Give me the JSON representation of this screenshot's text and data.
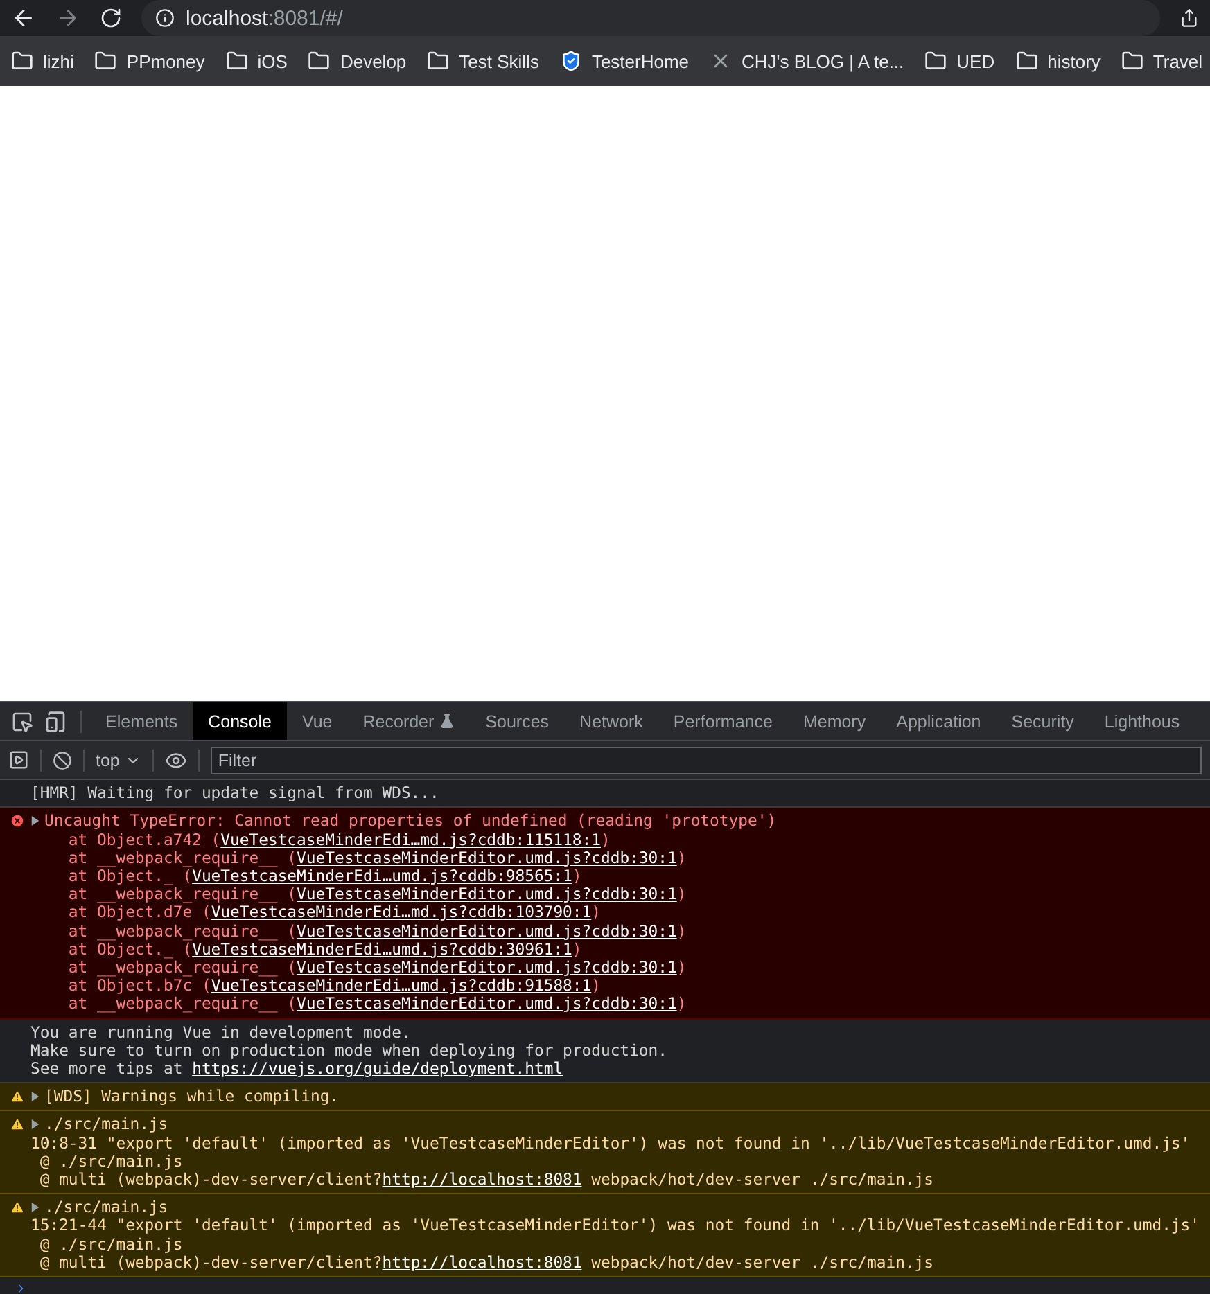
{
  "address_bar": {
    "host": "localhost",
    "path": ":8081/#/"
  },
  "bookmarks": [
    {
      "label": "lizhi",
      "kind": "folder"
    },
    {
      "label": "PPmoney",
      "kind": "folder"
    },
    {
      "label": "iOS",
      "kind": "folder"
    },
    {
      "label": "Develop",
      "kind": "folder"
    },
    {
      "label": "Test Skills",
      "kind": "folder"
    },
    {
      "label": "TesterHome",
      "kind": "shield"
    },
    {
      "label": "CHJ's BLOG | A te...",
      "kind": "site"
    },
    {
      "label": "UED",
      "kind": "folder"
    },
    {
      "label": "history",
      "kind": "folder"
    },
    {
      "label": "Travel",
      "kind": "folder"
    }
  ],
  "devtools": {
    "tabs": [
      {
        "label": "Elements",
        "selected": false
      },
      {
        "label": "Console",
        "selected": true
      },
      {
        "label": "Vue",
        "selected": false
      },
      {
        "label": "Recorder",
        "selected": false,
        "kind": "experimental"
      },
      {
        "label": "Sources",
        "selected": false
      },
      {
        "label": "Network",
        "selected": false
      },
      {
        "label": "Performance",
        "selected": false
      },
      {
        "label": "Memory",
        "selected": false
      },
      {
        "label": "Application",
        "selected": false
      },
      {
        "label": "Security",
        "selected": false
      },
      {
        "label": "Lighthous",
        "selected": false
      }
    ],
    "context": "top",
    "filter": {
      "placeholder": "Filter"
    }
  },
  "console": [
    {
      "kind": "log",
      "lines": [
        [
          {
            "text": "[HMR] Waiting for update signal from WDS..."
          }
        ]
      ]
    },
    {
      "kind": "error",
      "expanded": false,
      "lines": [
        [
          {
            "text": "Uncaught TypeError: Cannot read properties of undefined (reading 'prototype')"
          }
        ],
        [
          {
            "text": "    at Object.a742 ("
          },
          {
            "text": "VueTestcaseMinderEdi…md.js?cddb:115118:1",
            "kind": "link"
          },
          {
            "text": ")"
          }
        ],
        [
          {
            "text": "    at __webpack_require__ ("
          },
          {
            "text": "VueTestcaseMinderEditor.umd.js?cddb:30:1",
            "kind": "link"
          },
          {
            "text": ")"
          }
        ],
        [
          {
            "text": "    at Object._ ("
          },
          {
            "text": "VueTestcaseMinderEdi…umd.js?cddb:98565:1",
            "kind": "link"
          },
          {
            "text": ")"
          }
        ],
        [
          {
            "text": "    at __webpack_require__ ("
          },
          {
            "text": "VueTestcaseMinderEditor.umd.js?cddb:30:1",
            "kind": "link"
          },
          {
            "text": ")"
          }
        ],
        [
          {
            "text": "    at Object.d7e ("
          },
          {
            "text": "VueTestcaseMinderEdi…md.js?cddb:103790:1",
            "kind": "link"
          },
          {
            "text": ")"
          }
        ],
        [
          {
            "text": "    at __webpack_require__ ("
          },
          {
            "text": "VueTestcaseMinderEditor.umd.js?cddb:30:1",
            "kind": "link"
          },
          {
            "text": ")"
          }
        ],
        [
          {
            "text": "    at Object._ ("
          },
          {
            "text": "VueTestcaseMinderEdi…umd.js?cddb:30961:1",
            "kind": "link"
          },
          {
            "text": ")"
          }
        ],
        [
          {
            "text": "    at __webpack_require__ ("
          },
          {
            "text": "VueTestcaseMinderEditor.umd.js?cddb:30:1",
            "kind": "link"
          },
          {
            "text": ")"
          }
        ],
        [
          {
            "text": "    at Object.b7c ("
          },
          {
            "text": "VueTestcaseMinderEdi…umd.js?cddb:91588:1",
            "kind": "link"
          },
          {
            "text": ")"
          }
        ],
        [
          {
            "text": "    at __webpack_require__ ("
          },
          {
            "text": "VueTestcaseMinderEditor.umd.js?cddb:30:1",
            "kind": "link"
          },
          {
            "text": ")"
          }
        ]
      ]
    },
    {
      "kind": "log",
      "lines": [
        [
          {
            "text": "You are running Vue in development mode."
          }
        ],
        [
          {
            "text": "Make sure to turn on production mode when deploying for production."
          }
        ],
        [
          {
            "text": "See more tips at "
          },
          {
            "text": "https://vuejs.org/guide/deployment.html",
            "kind": "link"
          }
        ]
      ]
    },
    {
      "kind": "warning",
      "expanded": false,
      "lines": [
        [
          {
            "text": "[WDS] Warnings while compiling."
          }
        ]
      ]
    },
    {
      "kind": "warning",
      "expanded": false,
      "lines": [
        [
          {
            "text": "./src/main.js"
          }
        ],
        [
          {
            "text": "10:8-31 \"export 'default' (imported as 'VueTestcaseMinderEditor') was not found in '../lib/VueTestcaseMinderEditor.umd.js'"
          }
        ],
        [
          {
            "text": " @ ./src/main.js"
          }
        ],
        [
          {
            "text": " @ multi (webpack)-dev-server/client?"
          },
          {
            "text": "http://localhost:8081",
            "kind": "link"
          },
          {
            "text": " webpack/hot/dev-server ./src/main.js"
          }
        ]
      ]
    },
    {
      "kind": "warning",
      "expanded": false,
      "lines": [
        [
          {
            "text": "./src/main.js"
          }
        ],
        [
          {
            "text": "15:21-44 \"export 'default' (imported as 'VueTestcaseMinderEditor') was not found in '../lib/VueTestcaseMinderEditor.umd.js'"
          }
        ],
        [
          {
            "text": " @ ./src/main.js"
          }
        ],
        [
          {
            "text": " @ multi (webpack)-dev-server/client?"
          },
          {
            "text": "http://localhost:8081",
            "kind": "link"
          },
          {
            "text": " webpack/hot/dev-server ./src/main.js"
          }
        ]
      ]
    }
  ]
}
